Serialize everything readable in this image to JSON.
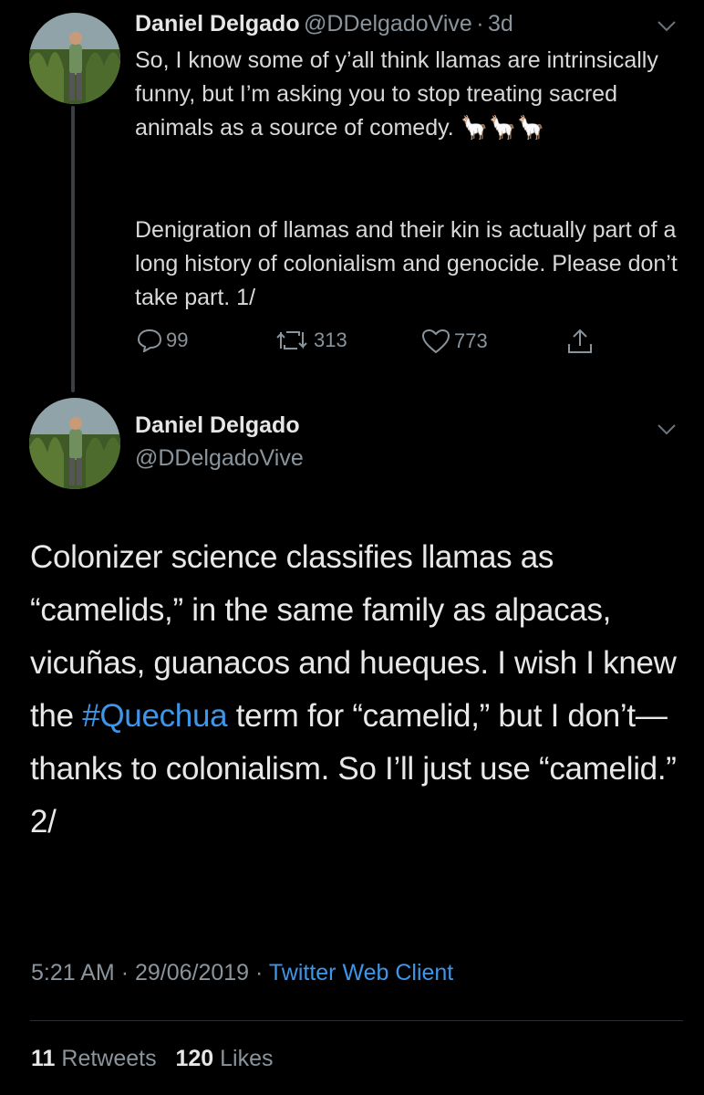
{
  "tweet1": {
    "name": "Daniel Delgado",
    "handle": "@DDelgadoVive",
    "separator": "·",
    "time": "3d",
    "text_part1": "So, I know some of y’all think llamas are intrinsically funny, but I’m asking you to stop treating sacred animals as a source of comedy. ",
    "emoji": "🦙🦙🦙",
    "text_part2": "Denigration of llamas and their kin is actually part of a long history of colonialism and genocide. Please don’t take part. 1/",
    "replies": "99",
    "retweets": "313",
    "likes": "773"
  },
  "tweet2": {
    "name": "Daniel Delgado",
    "handle": "@DDelgadoVive",
    "text_before_hashtag": "Colonizer science classifies llamas as “camelids,” in the same family as alpacas, vicuñas, guanacos and hueques. I wish I knew the ",
    "hashtag": "#Quechua",
    "text_after_hashtag": " term for “camelid,” but I don’t—thanks to colonialism. So I’ll just use “camelid.” 2/",
    "time": "5:21 AM",
    "date": "29/06/2019",
    "meta_sep": "·",
    "client": "Twitter Web Client",
    "retweet_count": "11",
    "retweet_label": "Retweets",
    "like_count": "120",
    "like_label": "Likes"
  },
  "colors": {
    "background": "#000000",
    "link": "#3d96e8",
    "muted": "#8a949c"
  }
}
